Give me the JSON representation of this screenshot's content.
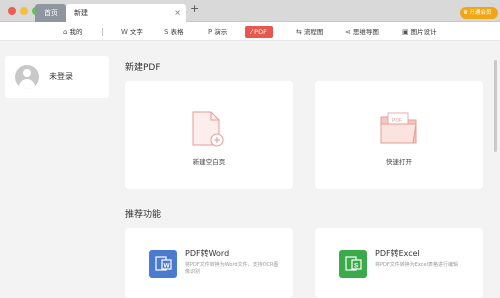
{
  "tabs": {
    "home": "首页",
    "current": "新建",
    "close": "×",
    "add": "+"
  },
  "member_button": "开通会员",
  "toolbar": {
    "mine": "我的",
    "writer": "文字",
    "table": "表格",
    "present": "演示",
    "pdf": "PDF",
    "flowchart": "流程图",
    "mindmap": "思维导图",
    "image_design": "图片设计"
  },
  "user": {
    "status": "未登录"
  },
  "new_pdf": {
    "title": "新建PDF",
    "blank_label": "新建空白页",
    "open_label": "快速打开",
    "folder_badge": "PDF"
  },
  "recommend": {
    "title": "推荐功能",
    "items": [
      {
        "title": "PDF转Word",
        "desc": "将PDF文件转换为Word文件，支持OCR图像识别",
        "icon": "word-icon",
        "color": "#4a7bd1"
      },
      {
        "title": "PDF转Excel",
        "desc": "将PDF文件转换为Excel表格进行编辑",
        "icon": "excel-icon",
        "color": "#3aaa4a"
      }
    ]
  },
  "colors": {
    "accent": "#e8574e",
    "member": "#f3a613"
  }
}
